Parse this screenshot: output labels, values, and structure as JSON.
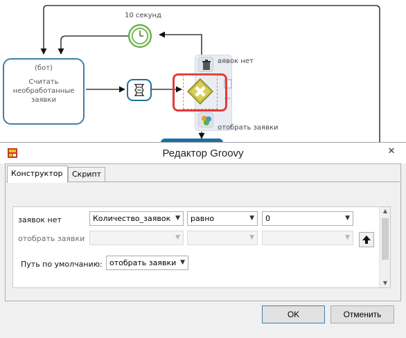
{
  "canvas": {
    "timer_label": "10 секунд",
    "task": {
      "line1": "(бот)",
      "line2": "Считать необработанные заявки"
    },
    "flow_label_1": "аявок нет",
    "flow_label_2": "отобрать заявки"
  },
  "dialog": {
    "title": "Редактор Groovy",
    "close_glyph": "✕",
    "tabs": [
      {
        "label": "Конструктор",
        "active": true
      },
      {
        "label": "Скрипт",
        "active": false
      }
    ],
    "rows": [
      {
        "label": "заявок нет",
        "variable": "Количество_заявок",
        "operator": "равно",
        "value": "0",
        "enabled": true
      },
      {
        "label": "отобрать заявки",
        "variable": "",
        "operator": "",
        "value": "",
        "enabled": false
      }
    ],
    "default_path_label": "Путь по умолчанию:",
    "default_path_value": "отобрать заявки",
    "up_button_icon": "arrow-up-icon",
    "ok_label": "OK",
    "cancel_label": "Отменить"
  },
  "colors": {
    "task_border": "#3f7fa8",
    "selection_red": "#e23a3a",
    "gateway_fill": "#c9c14a",
    "timer_green": "#5aa83a"
  }
}
